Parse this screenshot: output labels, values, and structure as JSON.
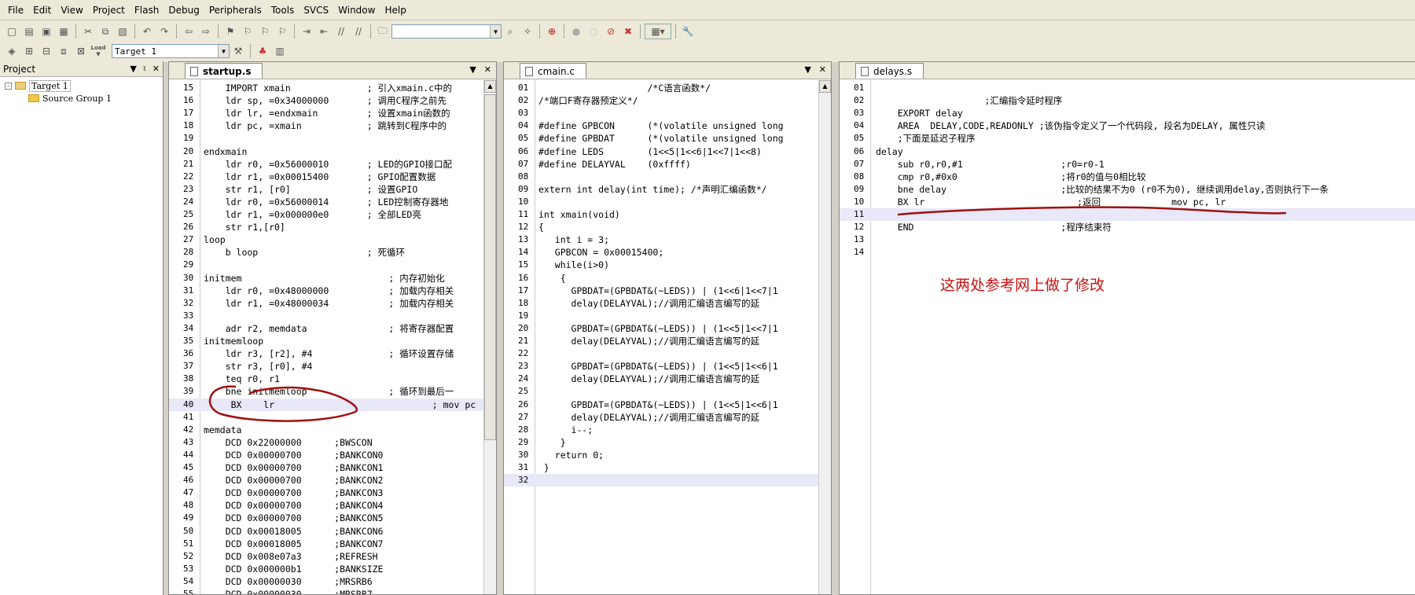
{
  "menu": [
    "File",
    "Edit",
    "View",
    "Project",
    "Flash",
    "Debug",
    "Peripherals",
    "Tools",
    "SVCS",
    "Window",
    "Help"
  ],
  "toolbar": {
    "target_select": "Target 1",
    "load_label": "Load"
  },
  "project_panel": {
    "title": "Project",
    "tree": [
      {
        "label": "Target 1",
        "expander": "-"
      },
      {
        "label": "Source Group 1"
      }
    ]
  },
  "editors": [
    {
      "tab": "startup.s",
      "lines": [
        {
          "n": "15",
          "t": "    IMPORT xmain              ; 引入xmain.c中的"
        },
        {
          "n": "16",
          "t": "    ldr sp, =0x34000000       ; 调用C程序之前先"
        },
        {
          "n": "17",
          "t": "    ldr lr, =endxmain         ; 设置xmain函数的"
        },
        {
          "n": "18",
          "t": "    ldr pc, =xmain            ; 跳转到C程序中的"
        },
        {
          "n": "19",
          "t": ""
        },
        {
          "n": "20",
          "t": "endxmain"
        },
        {
          "n": "21",
          "t": "    ldr r0, =0x56000010       ; LED的GPIO接口配"
        },
        {
          "n": "22",
          "t": "    ldr r1, =0x00015400       ; GPIO配置数据"
        },
        {
          "n": "23",
          "t": "    str r1, [r0]              ; 设置GPIO"
        },
        {
          "n": "24",
          "t": "    ldr r0, =0x56000014       ; LED控制寄存器地"
        },
        {
          "n": "25",
          "t": "    ldr r1, =0x000000e0       ; 全部LED亮"
        },
        {
          "n": "26",
          "t": "    str r1,[r0]"
        },
        {
          "n": "27",
          "t": "loop"
        },
        {
          "n": "28",
          "t": "    b loop                    ; 死循环"
        },
        {
          "n": "29",
          "t": ""
        },
        {
          "n": "30",
          "t": "initmem                           ; 内存初始化"
        },
        {
          "n": "31",
          "t": "    ldr r0, =0x48000000           ; 加载内存相关"
        },
        {
          "n": "32",
          "t": "    ldr r1, =0x48000034           ; 加载内存相关"
        },
        {
          "n": "33",
          "t": ""
        },
        {
          "n": "34",
          "t": "    adr r2, memdata               ; 将寄存器配置"
        },
        {
          "n": "35",
          "t": "initmemloop"
        },
        {
          "n": "36",
          "t": "    ldr r3, [r2], #4              ; 循环设置存储"
        },
        {
          "n": "37",
          "t": "    str r3, [r0], #4"
        },
        {
          "n": "38",
          "t": "    teq r0, r1"
        },
        {
          "n": "39",
          "t": "    bne initmemloop               ; 循环到最后一"
        },
        {
          "n": "40",
          "t": "     BX    lr                             ; mov pc"
        },
        {
          "n": "41",
          "t": ""
        },
        {
          "n": "42",
          "t": "memdata"
        },
        {
          "n": "43",
          "t": "    DCD 0x22000000      ;BWSCON"
        },
        {
          "n": "44",
          "t": "    DCD 0x00000700      ;BANKCON0"
        },
        {
          "n": "45",
          "t": "    DCD 0x00000700      ;BANKCON1"
        },
        {
          "n": "46",
          "t": "    DCD 0x00000700      ;BANKCON2"
        },
        {
          "n": "47",
          "t": "    DCD 0x00000700      ;BANKCON3"
        },
        {
          "n": "48",
          "t": "    DCD 0x00000700      ;BANKCON4"
        },
        {
          "n": "49",
          "t": "    DCD 0x00000700      ;BANKCON5"
        },
        {
          "n": "50",
          "t": "    DCD 0x00018005      ;BANKCON6"
        },
        {
          "n": "51",
          "t": "    DCD 0x00018005      ;BANKCON7"
        },
        {
          "n": "52",
          "t": "    DCD 0x008e07a3      ;REFRESH"
        },
        {
          "n": "53",
          "t": "    DCD 0x000000b1      ;BANKSIZE"
        },
        {
          "n": "54",
          "t": "    DCD 0x00000030      ;MRSRB6"
        },
        {
          "n": "55",
          "t": "    DCD 0x00000030      ;MRSRB7"
        }
      ]
    },
    {
      "tab": "cmain.c",
      "lines": [
        {
          "n": "01",
          "t": "                    /*C语言函数*/"
        },
        {
          "n": "02",
          "t": "/*端口F寄存器预定义*/"
        },
        {
          "n": "03",
          "t": ""
        },
        {
          "n": "04",
          "t": "#define GPBCON      (*(volatile unsigned long"
        },
        {
          "n": "05",
          "t": "#define GPBDAT      (*(volatile unsigned long"
        },
        {
          "n": "06",
          "t": "#define LEDS        (1<<5|1<<6|1<<7|1<<8)"
        },
        {
          "n": "07",
          "t": "#define DELAYVAL    (0xffff)"
        },
        {
          "n": "08",
          "t": ""
        },
        {
          "n": "09",
          "t": "extern int delay(int time); /*声明汇编函数*/"
        },
        {
          "n": "10",
          "t": ""
        },
        {
          "n": "11",
          "t": "int xmain(void)"
        },
        {
          "n": "12",
          "t": "{"
        },
        {
          "n": "13",
          "t": "   int i = 3;"
        },
        {
          "n": "14",
          "t": "   GPBCON = 0x00015400;"
        },
        {
          "n": "15",
          "t": "   while(i>0)"
        },
        {
          "n": "16",
          "t": "    {"
        },
        {
          "n": "17",
          "t": "      GPBDAT=(GPBDAT&(~LEDS)) | (1<<6|1<<7|1"
        },
        {
          "n": "18",
          "t": "      delay(DELAYVAL);//调用汇编语言编写的延"
        },
        {
          "n": "19",
          "t": ""
        },
        {
          "n": "20",
          "t": "      GPBDAT=(GPBDAT&(~LEDS)) | (1<<5|1<<7|1"
        },
        {
          "n": "21",
          "t": "      delay(DELAYVAL);//调用汇编语言编写的延"
        },
        {
          "n": "22",
          "t": ""
        },
        {
          "n": "23",
          "t": "      GPBDAT=(GPBDAT&(~LEDS)) | (1<<5|1<<6|1"
        },
        {
          "n": "24",
          "t": "      delay(DELAYVAL);//调用汇编语言编写的延"
        },
        {
          "n": "25",
          "t": ""
        },
        {
          "n": "26",
          "t": "      GPBDAT=(GPBDAT&(~LEDS)) | (1<<5|1<<6|1"
        },
        {
          "n": "27",
          "t": "      delay(DELAYVAL);//调用汇编语言编写的延"
        },
        {
          "n": "28",
          "t": "      i--;"
        },
        {
          "n": "29",
          "t": "    }"
        },
        {
          "n": "30",
          "t": "   return 0;"
        },
        {
          "n": "31",
          "t": " }"
        },
        {
          "n": "32",
          "t": ""
        }
      ]
    },
    {
      "tab": "delays.s",
      "lines": [
        {
          "n": "01",
          "t": ""
        },
        {
          "n": "02",
          "t": "                    ;汇编指令延时程序"
        },
        {
          "n": "03",
          "t": "    EXPORT delay"
        },
        {
          "n": "04",
          "t": "    AREA  DELAY,CODE,READONLY ;该伪指令定义了一个代码段, 段名为DELAY, 属性只读"
        },
        {
          "n": "05",
          "t": "    ;下面是延迟子程序"
        },
        {
          "n": "06",
          "t": "delay"
        },
        {
          "n": "07",
          "t": "    sub r0,r0,#1                  ;r0=r0-1"
        },
        {
          "n": "08",
          "t": "    cmp r0,#0x0                   ;将r0的值与0相比较"
        },
        {
          "n": "09",
          "t": "    bne delay                     ;比较的结果不为0 (r0不为0), 继续调用delay,否则执行下一条"
        },
        {
          "n": "10",
          "t": "    BX lr                            ;返回             mov pc, lr"
        },
        {
          "n": "11",
          "t": ""
        },
        {
          "n": "12",
          "t": "    END                           ;程序结束符"
        },
        {
          "n": "13",
          "t": ""
        },
        {
          "n": "14",
          "t": ""
        }
      ]
    }
  ],
  "annotation_text": "这两处参考网上做了修改",
  "colors": {
    "keyword": "#000080",
    "number": "#800080",
    "comment": "#008000",
    "cn_comment": "#0000c0",
    "highlight": "#e8e8f8",
    "annotation": "#cc1111"
  }
}
